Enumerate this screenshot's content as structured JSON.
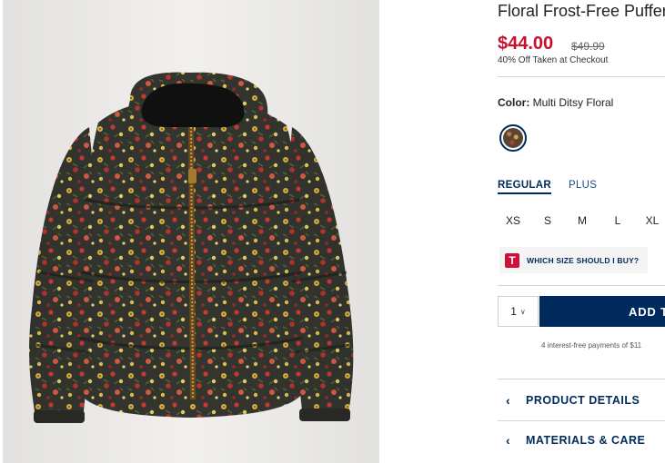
{
  "product": {
    "title": "Floral Frost-Free Puffer",
    "price": "$44.00",
    "original_price": "$49.99",
    "promo": "40% Off Taken at Checkout",
    "image_alt": "Floral puffer jacket"
  },
  "color": {
    "label": "Color:",
    "value": "Multi Ditsy Floral"
  },
  "size_tabs": [
    {
      "label": "REGULAR",
      "selected": true
    },
    {
      "label": "PLUS",
      "selected": false
    }
  ],
  "sizes": [
    "XS",
    "S",
    "M",
    "L",
    "XL"
  ],
  "size_help": {
    "icon_letter": "T",
    "label": "WHICH SIZE SHOULD I BUY?"
  },
  "cart": {
    "quantity": "1",
    "add_label": "ADD T"
  },
  "payment_note": "4 interest-free payments of $11",
  "accordion": [
    {
      "label": "PRODUCT DETAILS",
      "icon": "chevron-left-icon"
    },
    {
      "label": "MATERIALS & CARE",
      "icon": "chevron-left-icon"
    }
  ],
  "colors": {
    "brand_navy": "#002a5c",
    "sale_red": "#c8102e",
    "jacket_base": "#3a3b36"
  }
}
